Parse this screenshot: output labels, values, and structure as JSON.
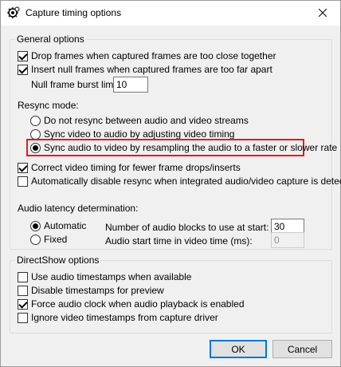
{
  "window": {
    "title": "Capture timing options",
    "title_icon": "gear-clock-icon",
    "close_icon": "close-icon"
  },
  "general": {
    "legend": "General options",
    "drop_frames": {
      "label": "Drop frames when captured frames are too close together",
      "checked": true
    },
    "insert_null": {
      "label": "Insert null frames when captured frames are too far apart",
      "checked": true
    },
    "null_burst_label": "Null frame burst limit:",
    "null_burst_value": "10",
    "resync_label": "Resync mode:",
    "resync_options": [
      {
        "label": "Do not resync between audio and video streams",
        "checked": false
      },
      {
        "label": "Sync video to audio by adjusting video timing",
        "checked": false
      },
      {
        "label": "Sync audio to video by resampling the audio to a faster or slower rate",
        "checked": true
      }
    ],
    "correct_timing": {
      "label": "Correct video timing for fewer frame drops/inserts",
      "checked": true
    },
    "auto_disable": {
      "label": "Automatically disable resync when integrated audio/video capture is detected",
      "checked": false
    },
    "audio_latency_label": "Audio latency determination:",
    "latency_options": [
      {
        "label": "Automatic",
        "checked": true
      },
      {
        "label": "Fixed",
        "checked": false
      }
    ],
    "blocks_label": "Number of audio blocks to use at start:",
    "blocks_value": "30",
    "start_time_label": "Audio start time in video time (ms):",
    "start_time_value": "0"
  },
  "directshow": {
    "legend": "DirectShow options",
    "options": [
      {
        "label": "Use audio timestamps when available",
        "checked": false
      },
      {
        "label": "Disable timestamps for preview",
        "checked": false
      },
      {
        "label": "Force audio clock when audio playback is enabled",
        "checked": true
      },
      {
        "label": "Ignore video timestamps from capture driver",
        "checked": false
      }
    ]
  },
  "buttons": {
    "ok": "OK",
    "cancel": "Cancel"
  },
  "colors": {
    "highlight": "#e8181d",
    "accent": "#0078d7"
  }
}
